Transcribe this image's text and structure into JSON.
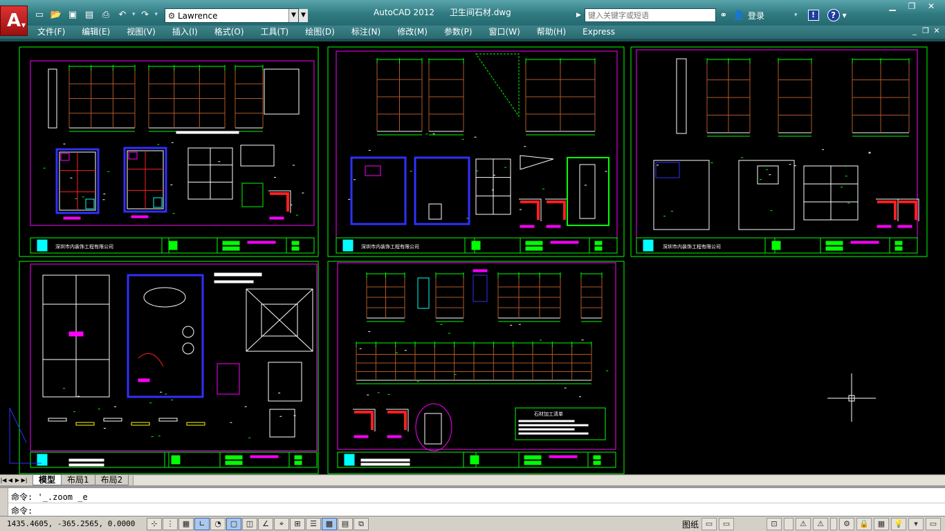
{
  "app": {
    "title": "AutoCAD 2012",
    "file": "卫生间石材.dwg",
    "logo_letter": "A"
  },
  "workspace": {
    "value": "Lawrence"
  },
  "search": {
    "placeholder": "键入关键字或短语"
  },
  "login": {
    "label": "登录"
  },
  "menu": [
    "文件(F)",
    "编辑(E)",
    "视图(V)",
    "插入(I)",
    "格式(O)",
    "工具(T)",
    "绘图(D)",
    "标注(N)",
    "修改(M)",
    "参数(P)",
    "窗口(W)",
    "帮助(H)",
    "Express"
  ],
  "icons": {
    "new": "new-file-icon",
    "open": "open-folder-icon",
    "save": "save-icon",
    "save_as": "save-as-icon",
    "print": "print-icon",
    "undo": "undo-icon",
    "redo": "redo-icon"
  },
  "layout_tabs": [
    "模型",
    "布局1",
    "布局2"
  ],
  "active_tab": "模型",
  "command": {
    "history": "命令: '_.zoom _e",
    "prompt": "命令:"
  },
  "status": {
    "coords": "1435.4605, -365.2565, 0.0000",
    "space": "图纸"
  },
  "drawing": {
    "sheet_company": "深圳市内装饰工程有限公司",
    "table_title": "石材加工清单",
    "colors": {
      "frame": "#00ff00",
      "inner": "#ff00ff",
      "wall": "#ffffff",
      "dim": "#00ff00",
      "accent": "#ff00ff",
      "cyan": "#00ffff",
      "red": "#ff2020",
      "blue": "#3030ff",
      "brown": "#b05a28",
      "yellow": "#ffff00"
    }
  }
}
